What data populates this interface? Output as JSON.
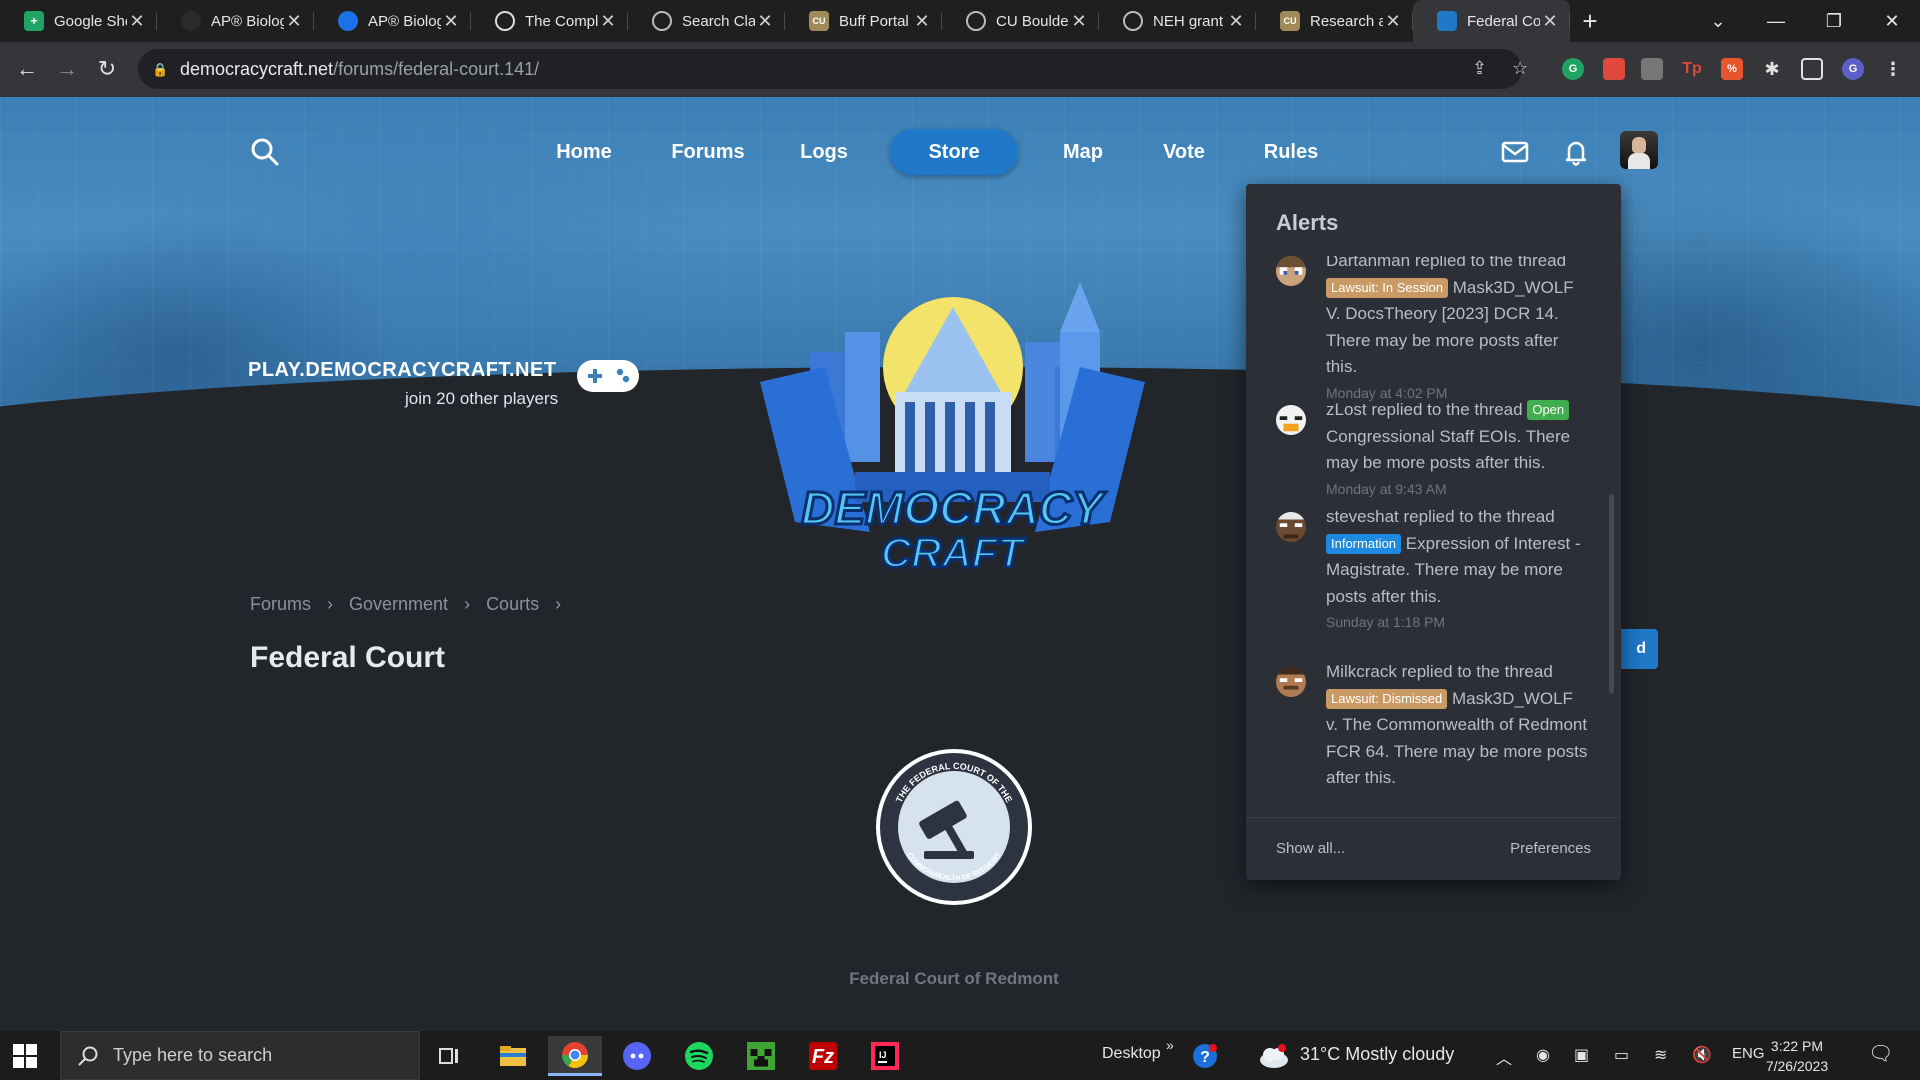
{
  "browser": {
    "tabs": [
      {
        "title": "Google Sheets",
        "color": "#1fa463",
        "glyph": "+"
      },
      {
        "title": "AP® Biology",
        "color": "#222222",
        "glyph": ""
      },
      {
        "title": "AP® Biology",
        "color": "#1a73e8",
        "glyph": ""
      },
      {
        "title": "The Complete",
        "color": "#333333",
        "glyph": ""
      },
      {
        "title": "Search Classes",
        "color": "#5f6368",
        "glyph": ""
      },
      {
        "title": "Buff Portal",
        "color": "#a08a5a",
        "glyph": "CU"
      },
      {
        "title": "CU Boulder",
        "color": "#5f6368",
        "glyph": ""
      },
      {
        "title": "NEH grant",
        "color": "#5f6368",
        "glyph": ""
      },
      {
        "title": "Research and",
        "color": "#a08a5a",
        "glyph": "CU"
      },
      {
        "title": "Federal Court",
        "color": "#1f78c8",
        "glyph": ""
      }
    ],
    "url_host": "democracycraft.net",
    "url_path": "/forums/federal-court.141/"
  },
  "site": {
    "nav": [
      "Home",
      "Forums",
      "Logs",
      "Store",
      "Map",
      "Vote",
      "Rules"
    ],
    "server_ip": "PLAY.DEMOCRACYCRAFT.NET",
    "players": "join 20 other players",
    "logo_line1": "DEMOCRACY",
    "logo_line2": "CRAFT"
  },
  "breadcrumb": [
    "Forums",
    "Government",
    "Courts"
  ],
  "page_title": "Federal Court",
  "post_button": "d",
  "seal_top": "THE FEDERAL COURT OF THE",
  "seal_bottom": "COMMONWEALTH OF REDMONT",
  "seal_caption": "Federal Court of Redmont",
  "alerts": {
    "title": "Alerts",
    "items": [
      {
        "user": "Dartanman",
        "action": "replied to the thread",
        "label": "Lawsuit: In Session",
        "text": "Mask3D_WOLF V. DocsTheory [2023] DCR 14. There may be more posts after this.",
        "time": "Monday at 4:02 PM"
      },
      {
        "user": "zLost",
        "action": "replied to the thread",
        "label": "Open",
        "text": "Congressional Staff EOIs. There may be more posts after this.",
        "time": "Monday at 9:43 AM"
      },
      {
        "user": "steveshat",
        "action": "replied to the thread",
        "label": "Information",
        "text": "Expression of Interest - Magistrate. There may be more posts after this.",
        "time": "Sunday at 1:18 PM"
      },
      {
        "user": "Milkcrack",
        "action": "replied to the thread",
        "label": "Lawsuit: Dismissed",
        "text": "Mask3D_WOLF v. The Commonwealth of Redmont FCR 64. There may be more posts after this.",
        "time": ""
      }
    ],
    "show_all": "Show all...",
    "preferences": "Preferences"
  },
  "taskbar": {
    "search_placeholder": "Type here to search",
    "desktop": "Desktop",
    "weather": "31°C  Mostly cloudy",
    "language": "ENG",
    "time": "3:22 PM",
    "date": "7/26/2023"
  }
}
